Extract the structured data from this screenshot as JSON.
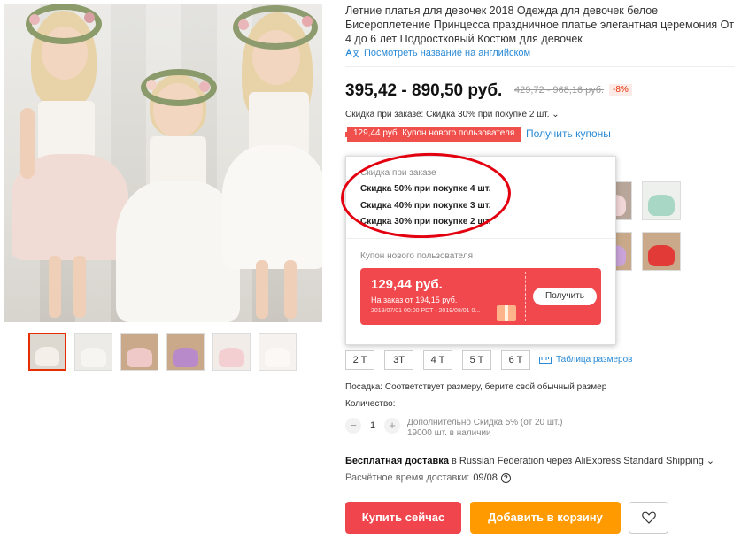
{
  "product": {
    "title": "Летние платья для девочек 2018 Одежда для девочек белое Бисероплетение Принцесса праздничное платье элегантная церемония От 4 до 6 лет Подростковый Костюм для девочек",
    "translate_link": "Посмотреть название на английском",
    "price_range": "395,42 - 890,50 руб.",
    "old_price_range": "429,72 - 968,16 руб.",
    "discount_badge": "-8%",
    "order_discount": "Скидка при заказе: Скидка 30% при покупке 2 шт.",
    "order_discount_chevron": "⌄",
    "coupon_chip": "129,44 руб. Купон нового пользователя",
    "get_coupons": "Получить купоны"
  },
  "popover": {
    "discount_title": "Скидка при заказе",
    "tiers": [
      "Скидка 50% при покупке 4 шт.",
      "Скидка 40% при покупке 3 шт.",
      "Скидка 30% при покупке 2 шт."
    ],
    "coupon_title": "Купон нового пользователя",
    "coupon": {
      "amount": "129,44 руб.",
      "condition": "На заказ от   194,15 руб.",
      "dates": "2019/07/01 00:00 PDT - 2019/08/01 0...",
      "button": "Получить"
    }
  },
  "sizes": [
    "2 T",
    "3T",
    "4 T",
    "5 T",
    "6 T"
  ],
  "size_table": "Таблица размеров",
  "fit": "Посадка: Соответствует размеру, берите свой обычный размер",
  "quantity": {
    "label": "Количество:",
    "minus": "−",
    "value": "1",
    "plus": "+",
    "info_line1": "Дополнительно Скидка 5% (от 20 шт.)",
    "info_line2": "19000 шт. в наличии"
  },
  "shipping": {
    "bold": "Бесплатная доставка",
    "rest": " в Russian Federation через AliExpress Standard Shipping ⌄",
    "delivery_label": "Расчётное время доставки:",
    "delivery_value": "09/08"
  },
  "actions": {
    "buy_now": "Купить сейчас",
    "add_to_cart": "Добавить в корзину"
  },
  "colors": {
    "accent_red": "#f0454c",
    "accent_orange": "#ff9a00",
    "link_blue": "#2a8ad5",
    "annotation_red": "#e3000f"
  }
}
